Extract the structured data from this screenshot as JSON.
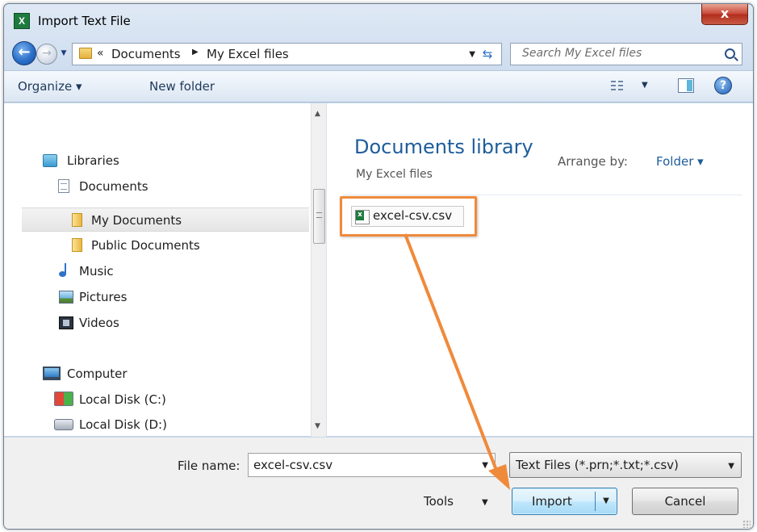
{
  "window": {
    "title": "Import Text File",
    "close_glyph": "x",
    "app_icon_glyph": "X"
  },
  "address": {
    "overflow_glyph": "«",
    "crumbs": [
      "Documents",
      "My Excel files"
    ],
    "search_placeholder": "Search My Excel files"
  },
  "toolbar": {
    "organize_label": "Organize ▾",
    "new_folder_label": "New folder",
    "help_glyph": "?"
  },
  "nav": {
    "items": [
      {
        "label": "Libraries",
        "icon": "library-icon"
      },
      {
        "label": "Documents",
        "icon": "document-icon"
      },
      {
        "label": "My Documents",
        "icon": "folder-icon",
        "selected": true
      },
      {
        "label": "Public Documents",
        "icon": "folder-icon"
      },
      {
        "label": "Music",
        "icon": "music-icon"
      },
      {
        "label": "Pictures",
        "icon": "pictures-icon"
      },
      {
        "label": "Videos",
        "icon": "videos-icon"
      },
      {
        "label": "Computer",
        "icon": "computer-icon"
      },
      {
        "label": "Local Disk (C:)",
        "icon": "windows-disk-icon"
      },
      {
        "label": "Local Disk (D:)",
        "icon": "disk-icon"
      }
    ]
  },
  "library": {
    "title": "Documents library",
    "subtitle": "My Excel files",
    "arrange_label": "Arrange by:",
    "arrange_value": "Folder ▾"
  },
  "files": [
    {
      "name": "excel-csv.csv",
      "icon": "excel-csv-icon",
      "highlighted": true
    }
  ],
  "form": {
    "file_name_label": "File name:",
    "file_name_value": "excel-csv.csv",
    "file_type_value": "Text Files (*.prn;*.txt;*.csv)",
    "tools_label": "Tools",
    "import_label": "Import",
    "cancel_label": "Cancel"
  },
  "colors": {
    "accent": "#1e5d9b",
    "annotation": "#ef8a3b",
    "close": "#c9493a"
  }
}
